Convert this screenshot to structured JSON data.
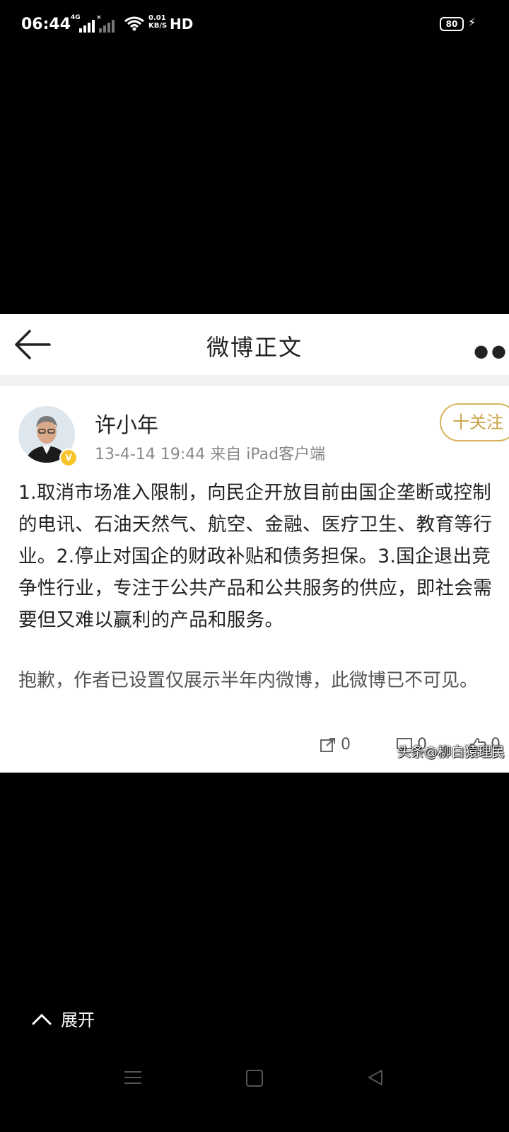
{
  "status_bar": {
    "time": "06:44",
    "network1": "4G",
    "speed_value": "0.01",
    "speed_unit": "KB/S",
    "hd": "HD",
    "battery": "80"
  },
  "nav": {
    "back_icon": "back-arrow-icon",
    "title": "微博正文",
    "more_icon": "more-dots-icon"
  },
  "post": {
    "username": "许小年",
    "meta": "13-4-14 19:44  来自 iPad客户端",
    "follow_label": "十关注",
    "verified_badge": "V",
    "content": "1.取消市场准入限制，向民企开放目前由国企垄断或控制的电讯、石油天然气、航空、金融、医疗卫生、教育等行业。2.停止对国企的财政补贴和债务担保。3.国企退出竞争性行业，专注于公共产品和公共服务的供应，即社会需要但又难以赢利的产品和服务。",
    "notice": "抱歉，作者已设置仅展示半年内微博，此微博已不可见。",
    "share_count": "0",
    "comment_count": "0",
    "like_count": "0",
    "watermark": "头条@柳白猿理民"
  },
  "expand_label": "展开",
  "colors": {
    "background": "#000000",
    "card": "#ffffff",
    "follow_accent": "#d8b45c",
    "verified": "#f7c52b"
  }
}
